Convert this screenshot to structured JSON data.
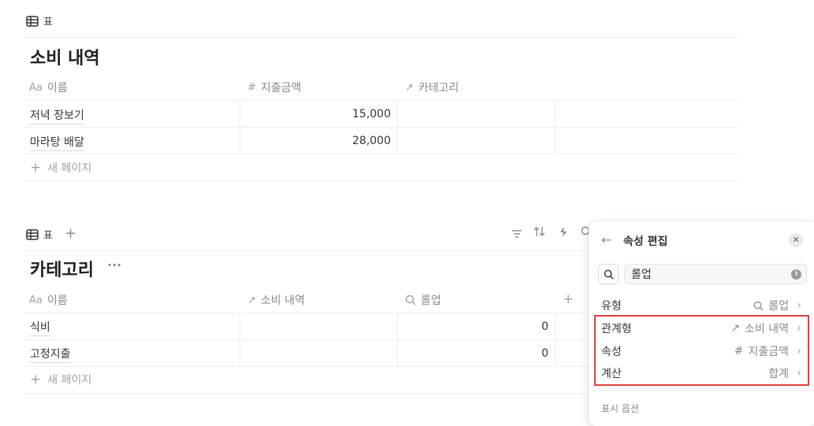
{
  "db1": {
    "view_tab": "표",
    "title": "소비 내역",
    "columns": [
      {
        "icon": "Aa",
        "label": "이름"
      },
      {
        "icon": "#",
        "label": "지출금액"
      },
      {
        "icon": "↗",
        "label": "카테고리"
      }
    ],
    "rows": [
      {
        "name": "저녁 장보기",
        "amount": "15,000"
      },
      {
        "name": "마라탕 배달",
        "amount": "28,000"
      }
    ],
    "new_page": "새 페이지"
  },
  "db2": {
    "view_tab": "표",
    "title": "카테고리",
    "more": "···",
    "columns": [
      {
        "icon": "Aa",
        "label": "이름"
      },
      {
        "icon": "↗",
        "label": "소비 내역"
      },
      {
        "icon": "search-icon",
        "label": "롤업"
      }
    ],
    "rows": [
      {
        "name": "식비",
        "rollup": "0"
      },
      {
        "name": "고정지출",
        "rollup": "0"
      }
    ],
    "new_page": "새 페이지"
  },
  "panel": {
    "title": "속성 편집",
    "name_value": "롤업",
    "rows": [
      {
        "label": "유형",
        "icon": "search-icon",
        "value": "롤업"
      },
      {
        "label": "관계형",
        "icon": "↗",
        "value": "소비 내역"
      },
      {
        "label": "속성",
        "icon": "#",
        "value": "지출금액"
      },
      {
        "label": "계산",
        "icon": "",
        "value": "합계"
      }
    ],
    "section_label": "표시 옵션",
    "highlight_color": "#e03e3e"
  }
}
